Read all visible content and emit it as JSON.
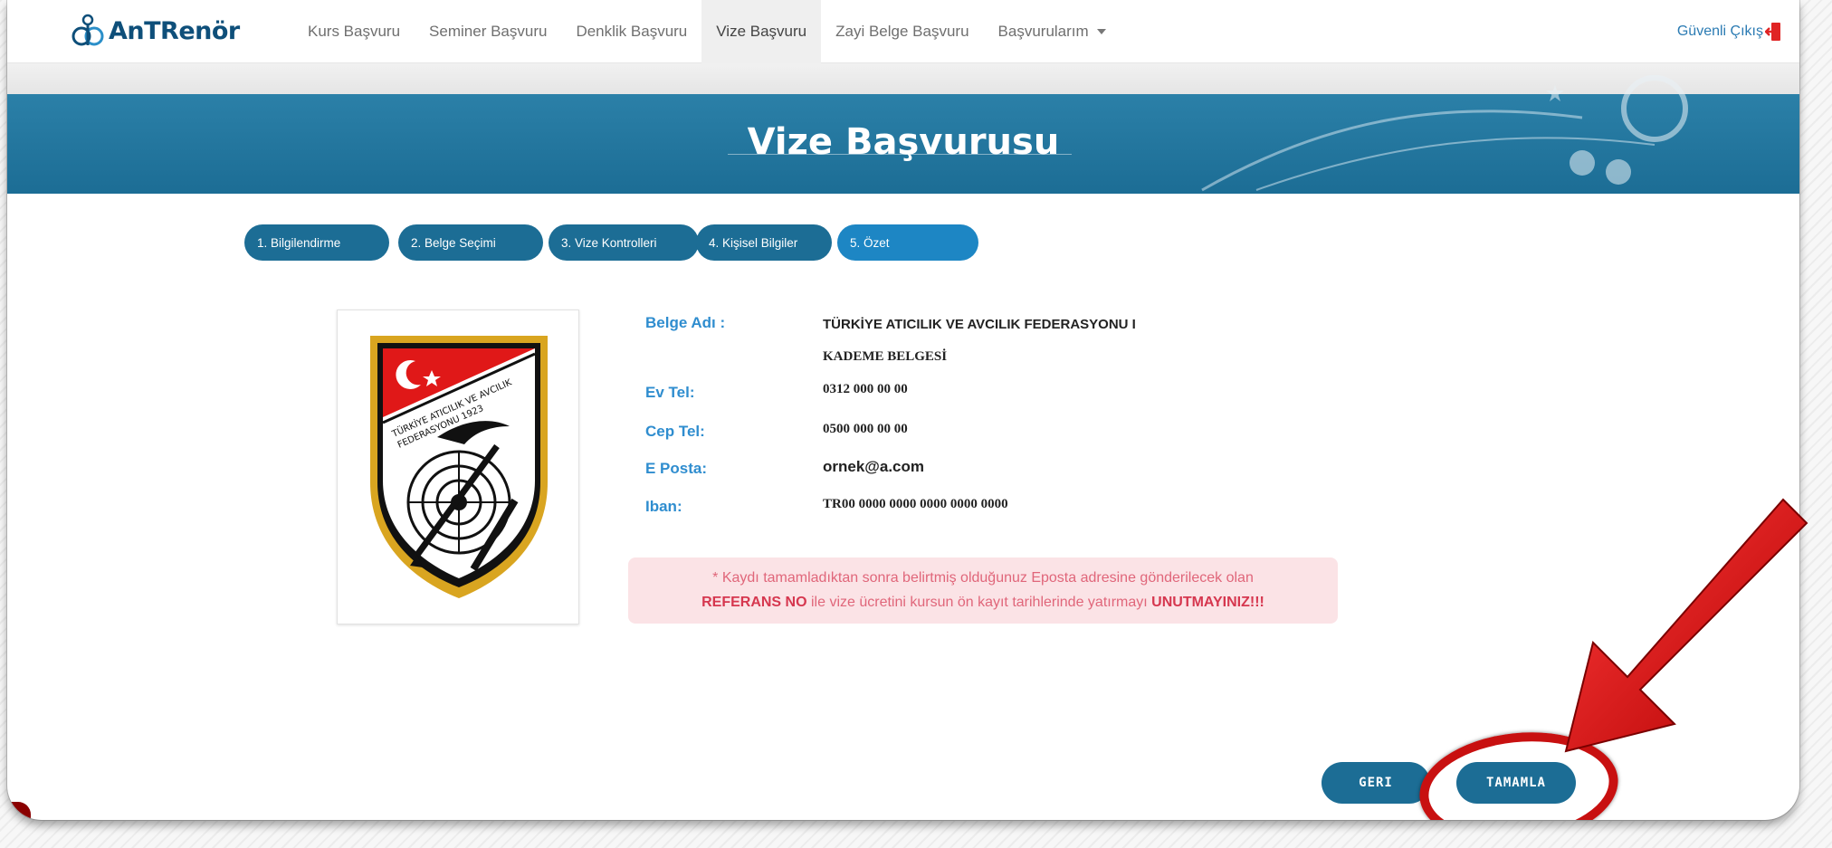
{
  "brand": {
    "name": "AnTRenör"
  },
  "nav": {
    "items": [
      {
        "label": "Kurs Başvuru"
      },
      {
        "label": "Seminer Başvuru"
      },
      {
        "label": "Denklik Başvuru"
      },
      {
        "label": "Vize Başvuru",
        "active": true
      },
      {
        "label": "Zayi Belge Başvuru"
      },
      {
        "label": "Başvurularım",
        "dropdown": true
      }
    ],
    "logout": "Güvenli Çıkış"
  },
  "hero": {
    "title": "Vize Başvurusu"
  },
  "steps": [
    {
      "label": "1. Bilgilendirme"
    },
    {
      "label": "2. Belge Seçimi"
    },
    {
      "label": "3. Vize Kontrolleri"
    },
    {
      "label": "4. Kişisel Bilgiler"
    },
    {
      "label": "5. Özet",
      "active": true
    }
  ],
  "logo": {
    "line1": "TÜRKİYE ATICILIK VE AVCILIK",
    "line2": "FEDERASYONU 1923"
  },
  "summary": {
    "belge_label": "Belge Adı :",
    "belge_value_1": "TÜRKİYE ATICILIK VE AVCILIK FEDERASYONU I",
    "belge_value_2": "KADEME BELGESİ",
    "evtel_label": "Ev Tel:",
    "evtel_value": "0312 000 00 00",
    "ceptel_label": "Cep Tel:",
    "ceptel_value": "0500 000 00 00",
    "eposta_label": "E Posta:",
    "eposta_value": "ornek@a.com",
    "iban_label": "Iban:",
    "iban_value": "TR00 0000 0000 0000 0000 0000"
  },
  "notice": {
    "line1": "* Kaydı tamamladıktan sonra belirtmiş olduğunuz Eposta adresine gönderilecek olan",
    "ref": "REFERANS NO",
    "middle": " ile vize ücretini kursun ön kayıt tarihlerinde yatırmayı ",
    "warn": "UNUTMAYINIZ!!!"
  },
  "buttons": {
    "back": "GERI",
    "complete": "TAMAMLA"
  },
  "colors": {
    "primary": "#1c6d95",
    "accent": "#2f8dcf",
    "annotation": "#c81010"
  }
}
